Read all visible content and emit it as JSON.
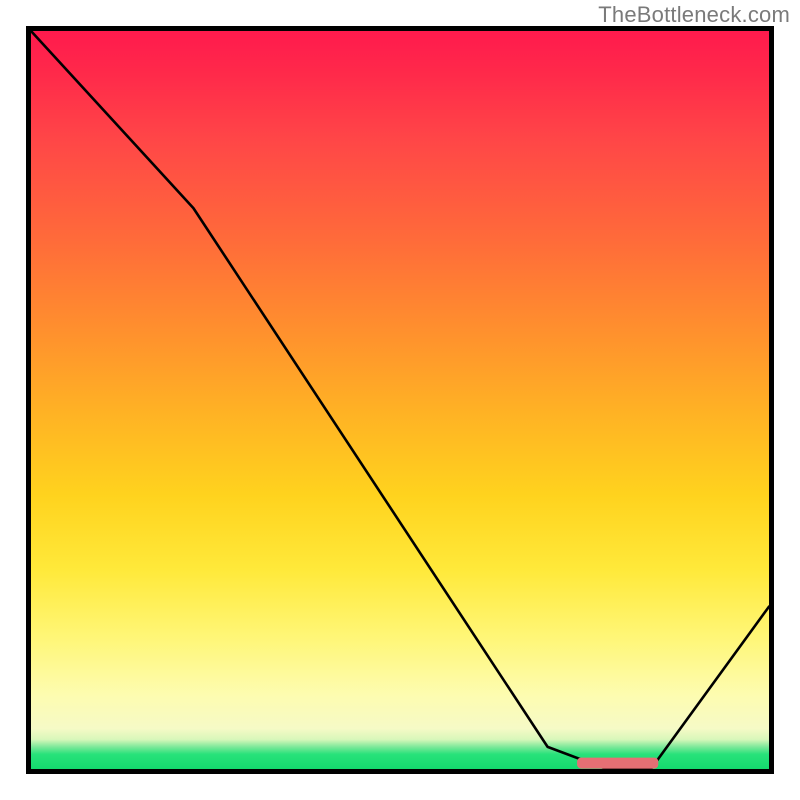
{
  "attribution": "TheBottleneck.com",
  "chart_data": {
    "type": "line",
    "title": "",
    "xlabel": "",
    "ylabel": "",
    "xlim": [
      0,
      100
    ],
    "ylim": [
      0,
      100
    ],
    "series": [
      {
        "name": "bottleneck-curve",
        "x": [
          0,
          22,
          70,
          78,
          84,
          100
        ],
        "y": [
          100,
          76,
          3,
          0,
          0,
          22
        ]
      }
    ],
    "marker": {
      "name": "optimal-range",
      "x_start": 74,
      "x_end": 85,
      "y": 0.8
    },
    "gradient_stops": [
      {
        "pct": 0,
        "color": "#ff1a4d"
      },
      {
        "pct": 50,
        "color": "#ffb324"
      },
      {
        "pct": 85,
        "color": "#fff676"
      },
      {
        "pct": 100,
        "color": "#14d96e"
      }
    ]
  }
}
